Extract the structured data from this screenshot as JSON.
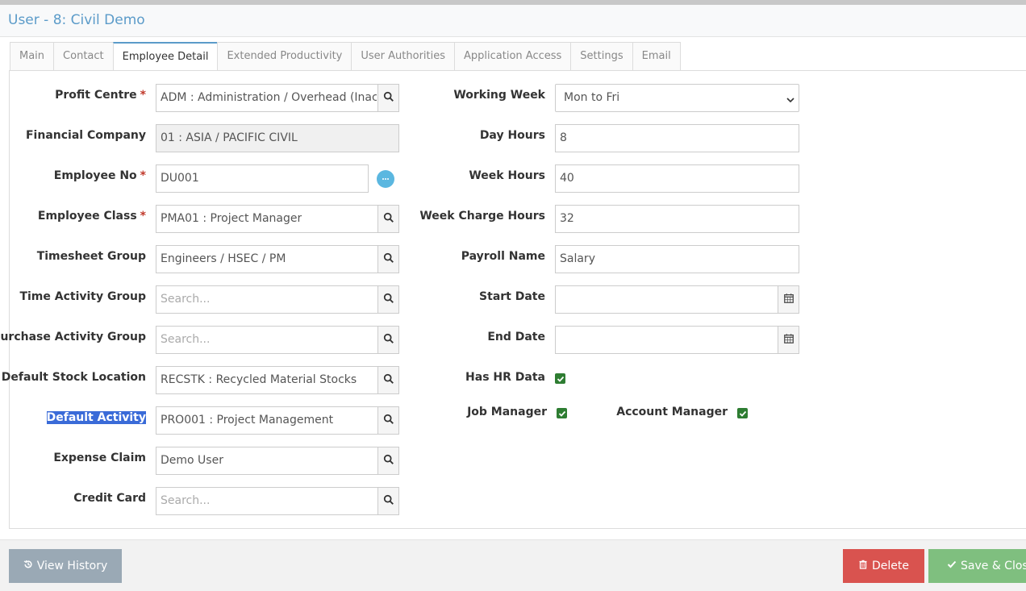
{
  "window": {
    "title": "User - 8: Civil Demo"
  },
  "tabs": [
    {
      "label": "Main"
    },
    {
      "label": "Contact"
    },
    {
      "label": "Employee Detail"
    },
    {
      "label": "Extended Productivity"
    },
    {
      "label": "User Authorities"
    },
    {
      "label": "Application Access"
    },
    {
      "label": "Settings"
    },
    {
      "label": "Email"
    }
  ],
  "active_tab": "Employee Detail",
  "left": {
    "profit_centre": {
      "label": "Profit Centre",
      "value": "ADM : Administration / Overhead (Inactiv"
    },
    "financial_company": {
      "label": "Financial Company",
      "value": "01 : ASIA / PACIFIC CIVIL"
    },
    "employee_no": {
      "label": "Employee No",
      "value": "DU001"
    },
    "employee_class": {
      "label": "Employee Class",
      "value": "PMA01 : Project Manager"
    },
    "timesheet_group": {
      "label": "Timesheet Group",
      "value": "Engineers / HSEC / PM"
    },
    "time_activity_group": {
      "label": "Time Activity Group",
      "placeholder": "Search..."
    },
    "purchase_activity_group": {
      "label": "Purchase Activity Group",
      "placeholder": "Search..."
    },
    "default_stock_location": {
      "label": "Default Stock Location",
      "value": "RECSTK : Recycled Material Stocks"
    },
    "default_activity": {
      "label": "Default Activity",
      "value": "PRO001 : Project Management"
    },
    "expense_claim": {
      "label": "Expense Claim",
      "value": "Demo User"
    },
    "credit_card": {
      "label": "Credit Card",
      "placeholder": "Search..."
    }
  },
  "required_mark": "*",
  "right": {
    "working_week": {
      "label": "Working Week",
      "value": "Mon to Fri"
    },
    "day_hours": {
      "label": "Day Hours",
      "value": "8"
    },
    "week_hours": {
      "label": "Week Hours",
      "value": "40"
    },
    "week_charge_hours": {
      "label": "Week Charge Hours",
      "value": "32"
    },
    "payroll_name": {
      "label": "Payroll Name",
      "value": "Salary"
    },
    "start_date": {
      "label": "Start Date",
      "value": ""
    },
    "end_date": {
      "label": "End Date",
      "value": ""
    },
    "has_hr_data": {
      "label": "Has HR Data",
      "checked": true
    },
    "job_manager": {
      "label": "Job Manager",
      "checked": true
    },
    "account_manager": {
      "label": "Account Manager",
      "checked": true
    }
  },
  "footer": {
    "view_history": "View History",
    "delete": "Delete",
    "save_close": "Save & Close"
  },
  "colors": {
    "title": "#5b9bc9",
    "checkbox": "#2e7d32",
    "delete": "#d9534f",
    "save": "#7fbf7f",
    "view_history": "#9aa9b5",
    "required": "#c0392b"
  }
}
